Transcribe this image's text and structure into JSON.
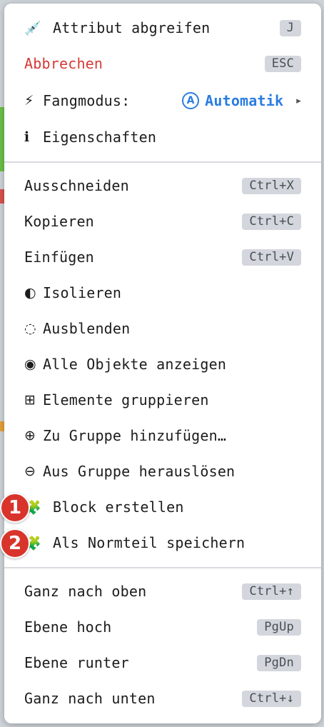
{
  "colors": {
    "danger": "#d63a35",
    "accent": "#2a7de1",
    "badge": "#d9342b",
    "shortcut_bg": "#d3d6dc"
  },
  "menu": {
    "top_items": [
      {
        "icon": "syringe-icon",
        "glyph": "💉",
        "label": "Attribut abgreifen",
        "shortcut": "J"
      },
      {
        "icon": "",
        "glyph": "",
        "label": "Abbrechen",
        "shortcut": "ESC"
      },
      {
        "icon": "lightning-icon",
        "glyph": "⚡",
        "label": "Fangmodus:",
        "value_glyph": "A",
        "value": "Automatik",
        "arrow": "▸"
      },
      {
        "icon": "info-icon",
        "glyph": "ℹ",
        "label": "Eigenschaften"
      }
    ],
    "edit_items": [
      {
        "label": "Ausschneiden",
        "shortcut": "Ctrl+X"
      },
      {
        "label": "Kopieren",
        "shortcut": "Ctrl+C"
      },
      {
        "label": "Einfügen",
        "shortcut": "Ctrl+V"
      },
      {
        "icon": "half-circle-icon",
        "glyph": "◐",
        "label": "Isolieren"
      },
      {
        "icon": "dotted-circle-icon",
        "glyph": "◌",
        "label": "Ausblenden"
      },
      {
        "icon": "filled-circle-icon",
        "glyph": "◉",
        "label": "Alle Objekte anzeigen"
      },
      {
        "icon": "grid-square-icon",
        "glyph": "⊞",
        "label": "Elemente gruppieren"
      },
      {
        "icon": "circled-plus-icon",
        "glyph": "⊕",
        "label": "Zu Gruppe hinzufügen…"
      },
      {
        "icon": "circled-minus-icon",
        "glyph": "⊖",
        "label": "Aus Gruppe herauslösen"
      },
      {
        "icon": "puzzle-icon",
        "glyph": "🧩",
        "label": "Block erstellen",
        "badge": "1"
      },
      {
        "icon": "puzzle-icon",
        "glyph": "🧩",
        "label": "Als Normteil speichern",
        "badge": "2"
      }
    ],
    "order_items": [
      {
        "label": "Ganz nach oben",
        "shortcut": "Ctrl+↑"
      },
      {
        "label": "Ebene hoch",
        "shortcut": "PgUp"
      },
      {
        "label": "Ebene runter",
        "shortcut": "PgDn"
      },
      {
        "label": "Ganz nach unten",
        "shortcut": "Ctrl+↓"
      }
    ]
  }
}
